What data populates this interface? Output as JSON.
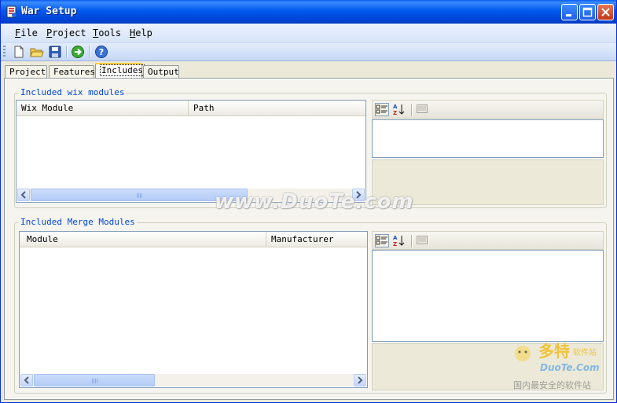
{
  "window": {
    "title": "War Setup"
  },
  "menu": [
    {
      "label": "File",
      "accel": "F",
      "rest": "ile"
    },
    {
      "label": "Project",
      "accel": "P",
      "rest": "roject"
    },
    {
      "label": "Tools",
      "accel": "T",
      "rest": "ools"
    },
    {
      "label": "Help",
      "accel": "H",
      "rest": "elp"
    }
  ],
  "toolbar": [
    "new-file-icon",
    "open-folder-icon",
    "save-icon",
    "run-icon",
    "help-icon"
  ],
  "tabs": [
    {
      "label": "Project",
      "active": false
    },
    {
      "label": "Features",
      "active": false
    },
    {
      "label": "Includes",
      "active": true
    },
    {
      "label": "Output",
      "active": false
    }
  ],
  "wix_group": {
    "label": "Included wix modules",
    "columns": [
      "Wix Module",
      "Path"
    ]
  },
  "merge_group": {
    "label": "Included Merge Modules",
    "columns": [
      "Module",
      "Manufacturer"
    ]
  },
  "watermark": {
    "site": "www.DuoTe.com",
    "logo_big": "多特",
    "logo_small": "软件站",
    "logo_domain": "DuoTe.Com",
    "logo_slogan": "国内最安全的软件站"
  },
  "colors": {
    "title_bar": "#0054E3",
    "group_label": "#0046D5",
    "tab_highlight": "#FFC83C"
  }
}
